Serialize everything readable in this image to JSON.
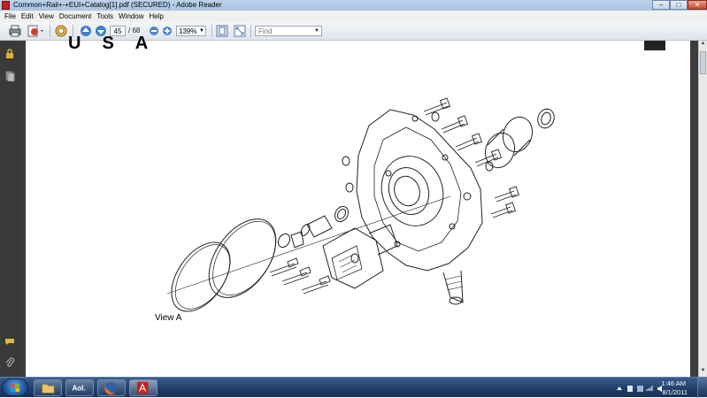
{
  "window": {
    "title": "Common+Rail+-+EUI+Catalog[1].pdf (SECURED) - Adobe Reader",
    "minimize_label": "–",
    "maximize_label": "□",
    "close_label": "✕"
  },
  "menu": [
    "File",
    "Edit",
    "View",
    "Document",
    "Tools",
    "Window",
    "Help"
  ],
  "toolbar": {
    "page_current": "45",
    "page_total": "/ 68",
    "zoom": "139%",
    "find_placeholder": "Find"
  },
  "document": {
    "header_letters": [
      "U",
      "S",
      "A"
    ],
    "view_label": "View A"
  },
  "taskbar": {
    "apps": [
      "windows-explorer",
      "aol",
      "firefox",
      "adobe-reader"
    ],
    "aol_label": "Aol.",
    "time": "1:46 AM",
    "date": "8/1/2011"
  },
  "colors": {
    "titlebar": "#bcd3ea",
    "taskbar": "#1f3d66",
    "nav_panel": "#3a3a3a"
  }
}
